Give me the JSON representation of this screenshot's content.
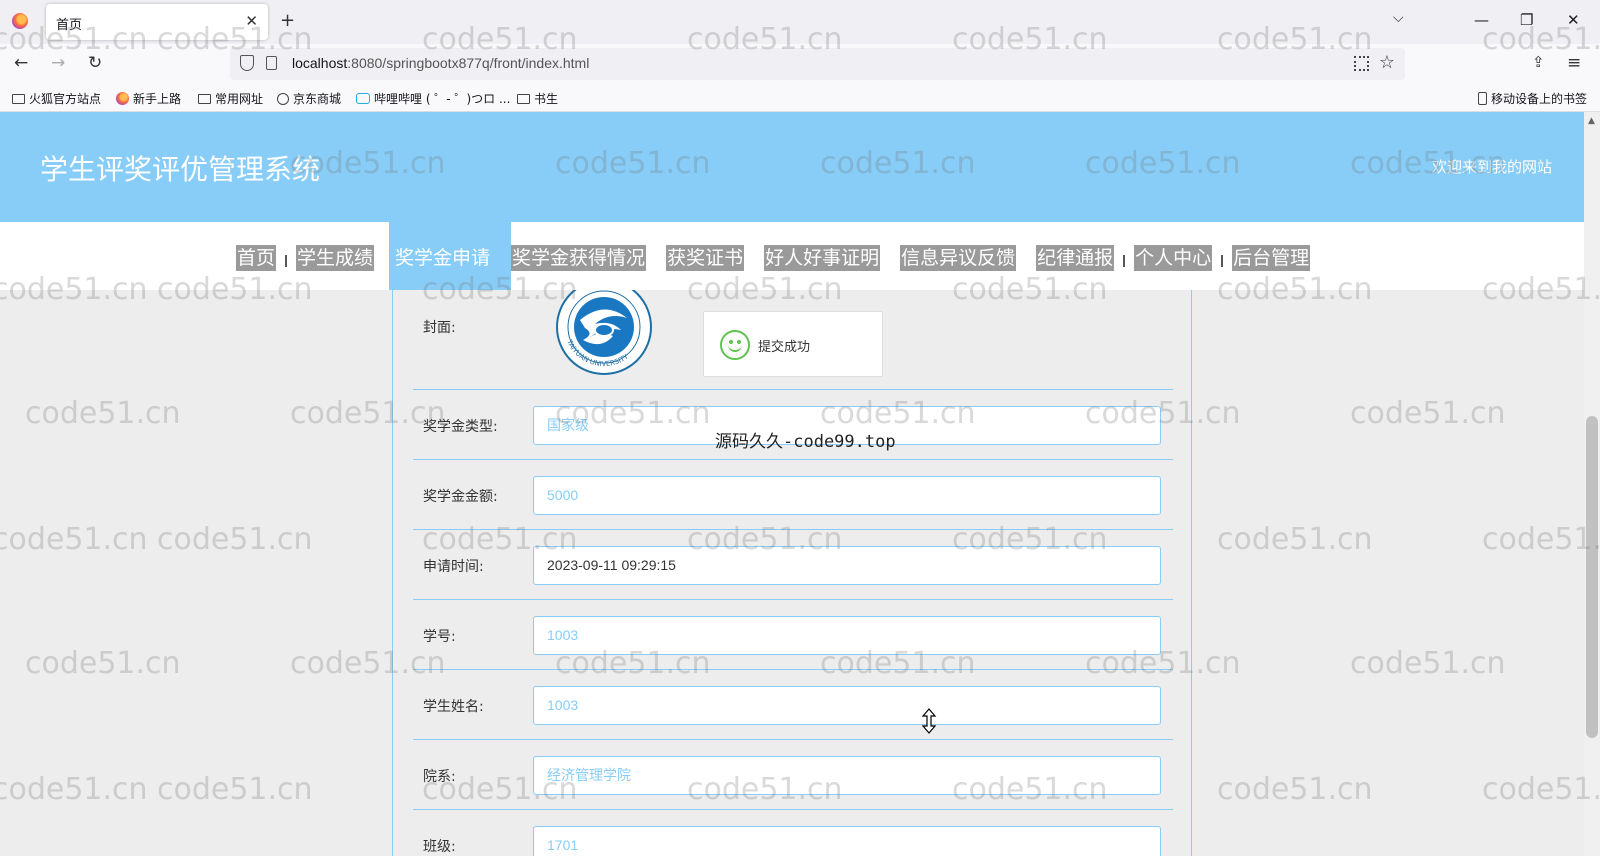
{
  "browser": {
    "tab_title": "首页",
    "url_host": "localhost",
    "url_rest": ":8080/springbootx877q/front/index.html",
    "bookmarks": [
      "火狐官方站点",
      "新手上路",
      "常用网址",
      "京东商城",
      "哔哩哔哩 ( ゜- ゜)つロ ...",
      "书生"
    ],
    "mobile_bookmarks": "移动设备上的书签"
  },
  "site": {
    "title": "学生评奖评优管理系统",
    "welcome": "欢迎来到我的网站"
  },
  "menu": [
    "首页",
    "学生成绩",
    "奖学金申请",
    "奖学金获得情况",
    "获奖证书",
    "好人好事证明",
    "信息异议反馈",
    "纪律通报",
    "个人中心",
    "后台管理"
  ],
  "form": {
    "cover_label": "封面:",
    "fields": [
      {
        "label": "奖学金类型:",
        "value": "国家级"
      },
      {
        "label": "奖学金金额:",
        "value": "5000"
      },
      {
        "label": "申请时间:",
        "value": "2023-09-11 09:29:15"
      },
      {
        "label": "学号:",
        "value": "1003"
      },
      {
        "label": "学生姓名:",
        "value": "1003"
      },
      {
        "label": "院系:",
        "value": "经济管理学院"
      },
      {
        "label": "班级:",
        "value": "1701"
      }
    ]
  },
  "toast": {
    "text": "提交成功"
  },
  "promo": "源码久久-code99.top",
  "seal_text": "TAIYUAN UNIVERSITY",
  "watermark": "code51.cn",
  "colors": {
    "accent": "#87cdf7",
    "menu_bg": "#9a9a9a",
    "success": "#5fc34f"
  }
}
